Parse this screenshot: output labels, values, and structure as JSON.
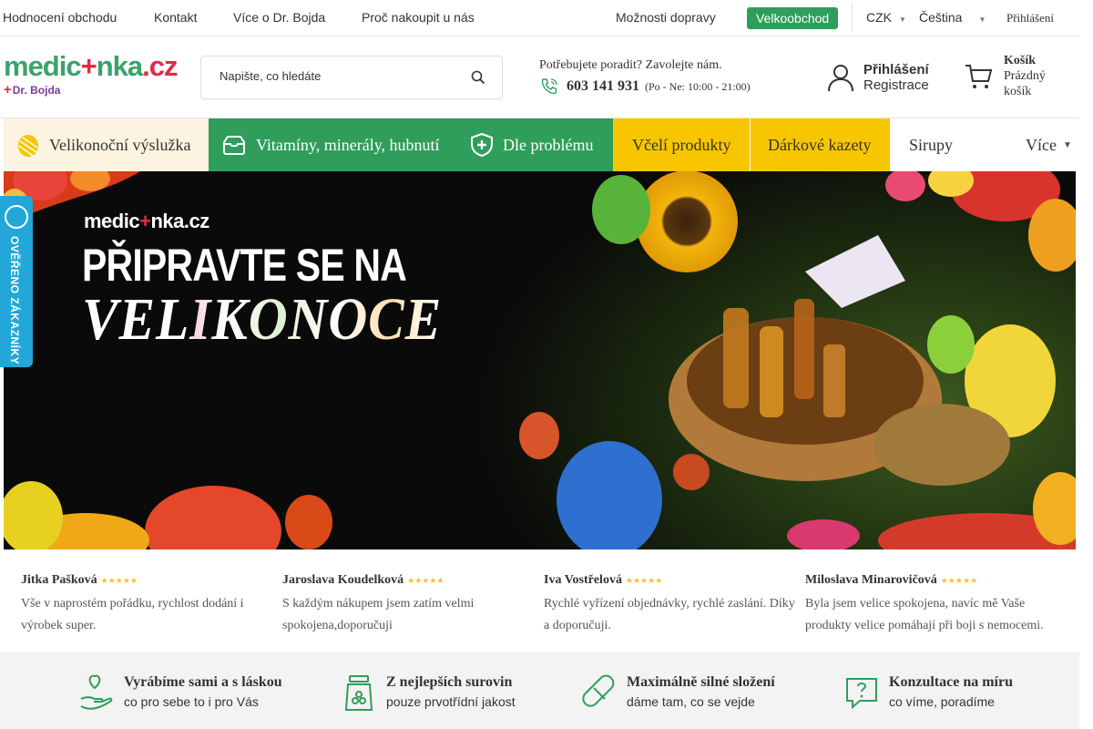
{
  "topbar": {
    "links": [
      "Hodnocení obchodu",
      "Kontakt",
      "Více o Dr. Bojda",
      "Proč nakoupit u nás"
    ],
    "shipping": "Možnosti dopravy",
    "wholesale": "Velkoobchod",
    "currency": "CZK",
    "language": "Čeština",
    "login": "Přihlášení"
  },
  "header": {
    "logo_parts": [
      "medic",
      "+",
      "nka",
      ".cz"
    ],
    "logo_sub": "Dr. Bojda",
    "search_placeholder": "Napište, co hledáte",
    "phone_prompt": "Potřebujete poradit? Zavolejte nám.",
    "phone_number": "603 141 931",
    "phone_hours": "(Po - Ne: 10:00 - 21:00)",
    "account_login": "Přihlášení",
    "account_register": "Registrace",
    "cart_title": "Košík",
    "cart_status_1": "Prázdný",
    "cart_status_2": "košík"
  },
  "categories": [
    {
      "label": "Velikonoční výslužka",
      "icon": "egg-icon"
    },
    {
      "label": "Vitamíny, minerály, hubnutí",
      "icon": "box-icon"
    },
    {
      "label": "Dle problému",
      "icon": "shield-plus-icon"
    },
    {
      "label": "Včelí produkty"
    },
    {
      "label": "Dárkové kazety"
    },
    {
      "label": "Sirupy"
    },
    {
      "label": "Více"
    }
  ],
  "banner": {
    "logo_parts": [
      "medic",
      "+",
      "nka.cz"
    ],
    "headline_1": "PŘIPRAVTE SE NA",
    "headline_2": "VELIKONOCE"
  },
  "badge": {
    "text": "OVĚŘENO ZÁKAZNÍKY"
  },
  "reviews": [
    {
      "name": "Jitka Pašková",
      "stars": 5,
      "text": "Vše v naprostém pořádku, rychlost dodání i výrobek super."
    },
    {
      "name": "Jaroslava Koudelková",
      "stars": 5,
      "text": "S každým nákupem jsem zatím velmi spokojena,doporučuji"
    },
    {
      "name": "Iva Vostřelová",
      "stars": 5,
      "text": "Rychlé vyřízení objednávky, rychlé zaslání. Díky a doporučuji."
    },
    {
      "name": "Miloslava Minarovičová",
      "stars": 5,
      "text": "Byla jsem velice spokojena, navíc mě Vaše produkty velice pomáhají při boji s nemocemi."
    }
  ],
  "features": [
    {
      "title": "Vyrábíme sami a s láskou",
      "subtitle": "co pro sebe to i pro Vás",
      "icon": "heart-hand-icon"
    },
    {
      "title": "Z nejlepších surovin",
      "subtitle": "pouze prvotřídní jakost",
      "icon": "jar-icon"
    },
    {
      "title": "Maximálně silné složení",
      "subtitle": "dáme tam, co se vejde",
      "icon": "pill-icon"
    },
    {
      "title": "Konzultace na míru",
      "subtitle": "co víme, poradíme",
      "icon": "question-chat-icon"
    }
  ],
  "colors": {
    "brand_green": "#2f9e5b",
    "brand_red": "#e02c43",
    "category_yellow": "#f7c600",
    "badge_blue": "#22a7d8",
    "star_gold": "#f2c230"
  }
}
